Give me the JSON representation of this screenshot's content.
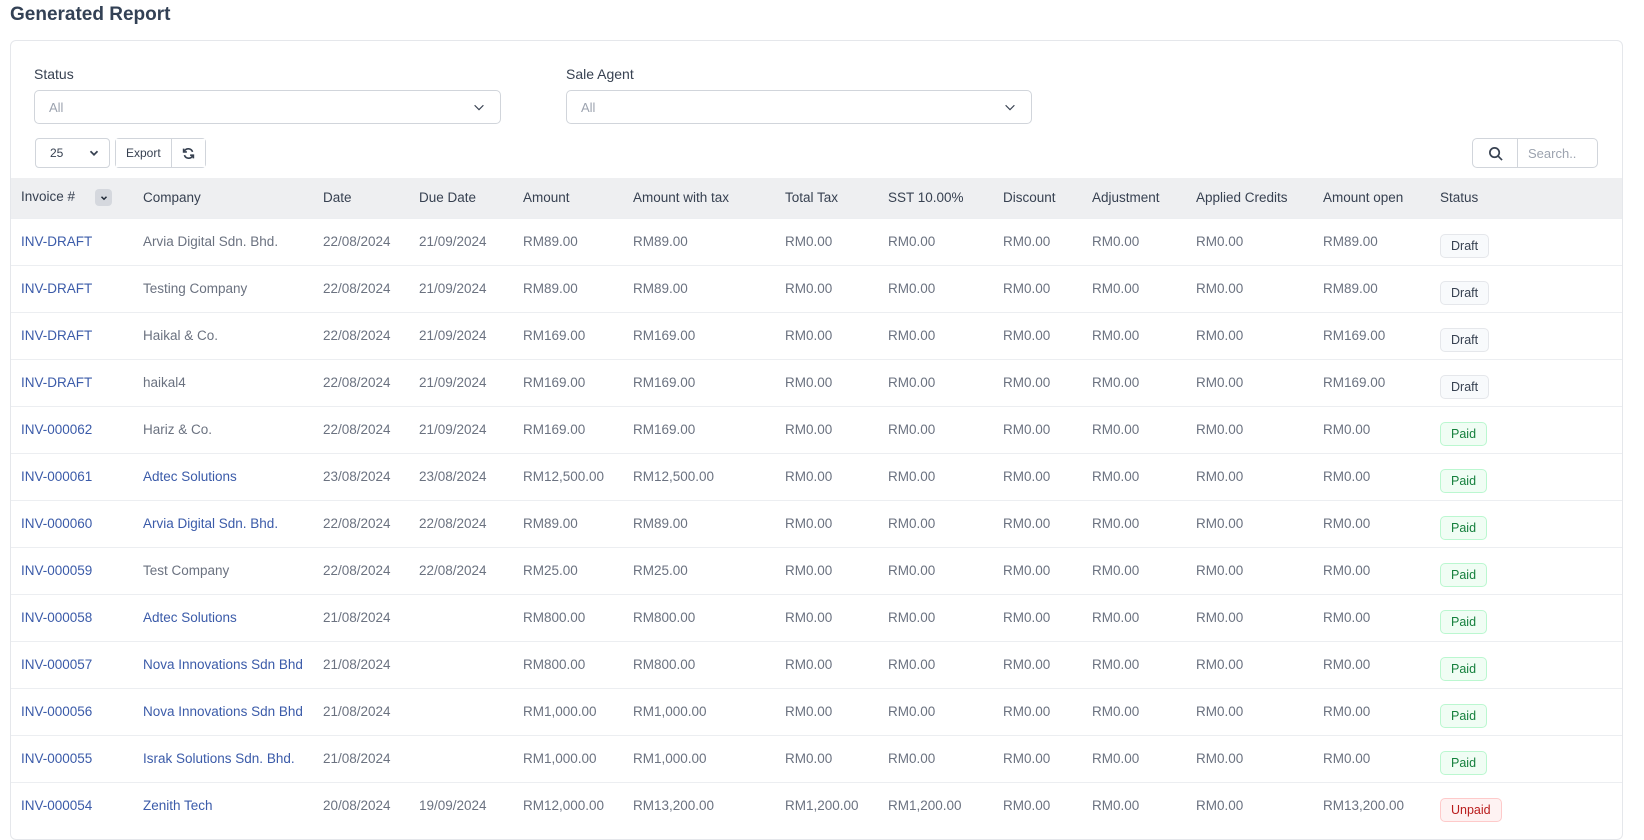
{
  "page": {
    "title": "Generated Report"
  },
  "filters": {
    "status": {
      "label": "Status",
      "value": "All"
    },
    "sale_agent": {
      "label": "Sale Agent",
      "value": "All"
    }
  },
  "toolbar": {
    "page_length": "25",
    "export_label": "Export",
    "search_placeholder": "Search.."
  },
  "table": {
    "columns": [
      "Invoice #",
      "Company",
      "Date",
      "Due Date",
      "Amount",
      "Amount with tax",
      "Total Tax",
      "SST 10.00%",
      "Discount",
      "Adjustment",
      "Applied Credits",
      "Amount open",
      "Status"
    ],
    "rows": [
      {
        "invoice": "INV-DRAFT",
        "company": "Arvia Digital Sdn. Bhd.",
        "company_link": false,
        "date": "22/08/2024",
        "due_date": "21/09/2024",
        "amount": "RM89.00",
        "amount_with_tax": "RM89.00",
        "total_tax": "RM0.00",
        "sst": "RM0.00",
        "discount": "RM0.00",
        "adjustment": "RM0.00",
        "applied_credits": "RM0.00",
        "amount_open": "RM89.00",
        "status": "Draft"
      },
      {
        "invoice": "INV-DRAFT",
        "company": "Testing Company",
        "company_link": false,
        "date": "22/08/2024",
        "due_date": "21/09/2024",
        "amount": "RM89.00",
        "amount_with_tax": "RM89.00",
        "total_tax": "RM0.00",
        "sst": "RM0.00",
        "discount": "RM0.00",
        "adjustment": "RM0.00",
        "applied_credits": "RM0.00",
        "amount_open": "RM89.00",
        "status": "Draft"
      },
      {
        "invoice": "INV-DRAFT",
        "company": "Haikal & Co.",
        "company_link": false,
        "date": "22/08/2024",
        "due_date": "21/09/2024",
        "amount": "RM169.00",
        "amount_with_tax": "RM169.00",
        "total_tax": "RM0.00",
        "sst": "RM0.00",
        "discount": "RM0.00",
        "adjustment": "RM0.00",
        "applied_credits": "RM0.00",
        "amount_open": "RM169.00",
        "status": "Draft"
      },
      {
        "invoice": "INV-DRAFT",
        "company": "haikal4",
        "company_link": false,
        "date": "22/08/2024",
        "due_date": "21/09/2024",
        "amount": "RM169.00",
        "amount_with_tax": "RM169.00",
        "total_tax": "RM0.00",
        "sst": "RM0.00",
        "discount": "RM0.00",
        "adjustment": "RM0.00",
        "applied_credits": "RM0.00",
        "amount_open": "RM169.00",
        "status": "Draft"
      },
      {
        "invoice": "INV-000062",
        "company": "Hariz & Co.",
        "company_link": false,
        "date": "22/08/2024",
        "due_date": "21/09/2024",
        "amount": "RM169.00",
        "amount_with_tax": "RM169.00",
        "total_tax": "RM0.00",
        "sst": "RM0.00",
        "discount": "RM0.00",
        "adjustment": "RM0.00",
        "applied_credits": "RM0.00",
        "amount_open": "RM0.00",
        "status": "Paid"
      },
      {
        "invoice": "INV-000061",
        "company": "Adtec Solutions",
        "company_link": true,
        "date": "23/08/2024",
        "due_date": "23/08/2024",
        "amount": "RM12,500.00",
        "amount_with_tax": "RM12,500.00",
        "total_tax": "RM0.00",
        "sst": "RM0.00",
        "discount": "RM0.00",
        "adjustment": "RM0.00",
        "applied_credits": "RM0.00",
        "amount_open": "RM0.00",
        "status": "Paid"
      },
      {
        "invoice": "INV-000060",
        "company": "Arvia Digital Sdn. Bhd.",
        "company_link": true,
        "date": "22/08/2024",
        "due_date": "22/08/2024",
        "amount": "RM89.00",
        "amount_with_tax": "RM89.00",
        "total_tax": "RM0.00",
        "sst": "RM0.00",
        "discount": "RM0.00",
        "adjustment": "RM0.00",
        "applied_credits": "RM0.00",
        "amount_open": "RM0.00",
        "status": "Paid"
      },
      {
        "invoice": "INV-000059",
        "company": "Test Company",
        "company_link": false,
        "date": "22/08/2024",
        "due_date": "22/08/2024",
        "amount": "RM25.00",
        "amount_with_tax": "RM25.00",
        "total_tax": "RM0.00",
        "sst": "RM0.00",
        "discount": "RM0.00",
        "adjustment": "RM0.00",
        "applied_credits": "RM0.00",
        "amount_open": "RM0.00",
        "status": "Paid"
      },
      {
        "invoice": "INV-000058",
        "company": "Adtec Solutions",
        "company_link": true,
        "date": "21/08/2024",
        "due_date": "",
        "amount": "RM800.00",
        "amount_with_tax": "RM800.00",
        "total_tax": "RM0.00",
        "sst": "RM0.00",
        "discount": "RM0.00",
        "adjustment": "RM0.00",
        "applied_credits": "RM0.00",
        "amount_open": "RM0.00",
        "status": "Paid"
      },
      {
        "invoice": "INV-000057",
        "company": "Nova Innovations Sdn Bhd",
        "company_link": true,
        "date": "21/08/2024",
        "due_date": "",
        "amount": "RM800.00",
        "amount_with_tax": "RM800.00",
        "total_tax": "RM0.00",
        "sst": "RM0.00",
        "discount": "RM0.00",
        "adjustment": "RM0.00",
        "applied_credits": "RM0.00",
        "amount_open": "RM0.00",
        "status": "Paid"
      },
      {
        "invoice": "INV-000056",
        "company": "Nova Innovations Sdn Bhd",
        "company_link": true,
        "date": "21/08/2024",
        "due_date": "",
        "amount": "RM1,000.00",
        "amount_with_tax": "RM1,000.00",
        "total_tax": "RM0.00",
        "sst": "RM0.00",
        "discount": "RM0.00",
        "adjustment": "RM0.00",
        "applied_credits": "RM0.00",
        "amount_open": "RM0.00",
        "status": "Paid"
      },
      {
        "invoice": "INV-000055",
        "company": "Israk Solutions Sdn. Bhd.",
        "company_link": true,
        "date": "21/08/2024",
        "due_date": "",
        "amount": "RM1,000.00",
        "amount_with_tax": "RM1,000.00",
        "total_tax": "RM0.00",
        "sst": "RM0.00",
        "discount": "RM0.00",
        "adjustment": "RM0.00",
        "applied_credits": "RM0.00",
        "amount_open": "RM0.00",
        "status": "Paid"
      },
      {
        "invoice": "INV-000054",
        "company": "Zenith Tech",
        "company_link": true,
        "date": "20/08/2024",
        "due_date": "19/09/2024",
        "amount": "RM12,000.00",
        "amount_with_tax": "RM13,200.00",
        "total_tax": "RM1,200.00",
        "sst": "RM1,200.00",
        "discount": "RM0.00",
        "adjustment": "RM0.00",
        "applied_credits": "RM0.00",
        "amount_open": "RM13,200.00",
        "status": "Unpaid"
      }
    ]
  }
}
